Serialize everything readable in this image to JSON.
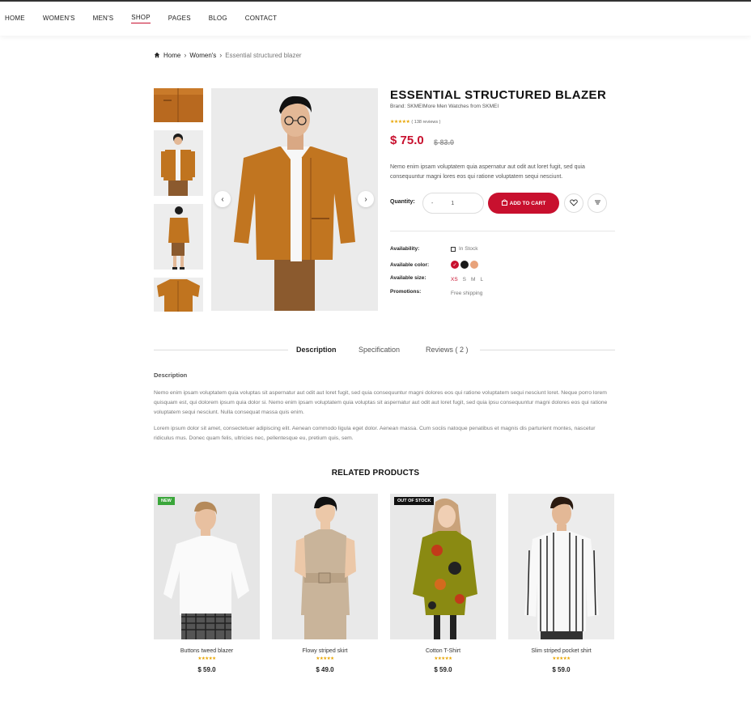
{
  "nav": {
    "items": [
      "HOME",
      "WOMEN'S",
      "MEN'S",
      "SHOP",
      "PAGES",
      "BLOG",
      "CONTACT"
    ],
    "active": "SHOP"
  },
  "breadcrumb": {
    "home": "Home",
    "category": "Women's",
    "current": "Essential structured blazer"
  },
  "product": {
    "title": "ESSENTIAL STRUCTURED BLAZER",
    "brand": "Brand: SKMEIMore Men Watches from SKMEI",
    "stars": "★★★★★",
    "reviews": "( 138 reviews )",
    "price": "$ 75.0",
    "old_price": "$ 83.0",
    "description": "Nemo enim ipsam voluptatem quia aspernatur aut odit aut loret fugit, sed quia consequuntur magni lores eos qui ratione voluptatem sequi nesciunt.",
    "quantity_label": "Quantity:",
    "quantity_minus": "-",
    "quantity_value": "1",
    "add_to_cart": "ADD TO CART",
    "availability_label": "Availability:",
    "availability_value": "In Stock",
    "color_label": "Available color:",
    "colors": [
      "#c8102e",
      "#1a1a1a",
      "#e8a27a"
    ],
    "size_label": "Available size:",
    "sizes": [
      "XS",
      "S",
      "M",
      "L"
    ],
    "promotions_label": "Promotions:",
    "promotions_value": "Free shipping"
  },
  "tabs": [
    "Description",
    "Specification",
    "Reviews ( 2 )"
  ],
  "description_section": {
    "heading": "Description",
    "paragraph1": "Nemo enim ipsam voluptatem quia voluptas sit aspernatur aut odit aut loret fugit, sed quia consequuntur magni dolores eos qui ratione voluptatem sequi nesciunt loret. Neque porro lorem quisquam est, qui dolorem ipsum quia dolor si. Nemo enim ipsam voluptatem quia voluptas sit aspernatur aut odit aut loret fugit, sed quia ipsu consequuntur magni dolores eos qui ratione voluptatem sequi nesciunt. Nulla consequat massa quis enim.",
    "paragraph2": "Lorem ipsum dolor sit amet, consectetuer adipiscing elit. Aenean commodo ligula eget dolor. Aenean massa. Cum sociis natoque penatibus et magnis dis parturient montes, nascetur ridiculus mus. Donec quam felis, ultricies nec, pellentesque eu, pretium quis, sem."
  },
  "related": {
    "title": "RELATED PRODUCTS",
    "items": [
      {
        "name": "Buttons tweed blazer",
        "stars": "★★★★★",
        "price": "$ 59.0",
        "badge": "NEW",
        "badge_color": "#3aa63a"
      },
      {
        "name": "Flowy striped skirt",
        "stars": "★★★★★",
        "price": "$ 49.0",
        "badge": "",
        "badge_color": ""
      },
      {
        "name": "Cotton T-Shirt",
        "stars": "★★★★★",
        "price": "$ 59.0",
        "badge": "OUT OF STOCK",
        "badge_color": "#111111"
      },
      {
        "name": "Slim striped pocket shirt",
        "stars": "★★★★★",
        "price": "$ 59.0",
        "badge": "",
        "badge_color": ""
      }
    ]
  }
}
